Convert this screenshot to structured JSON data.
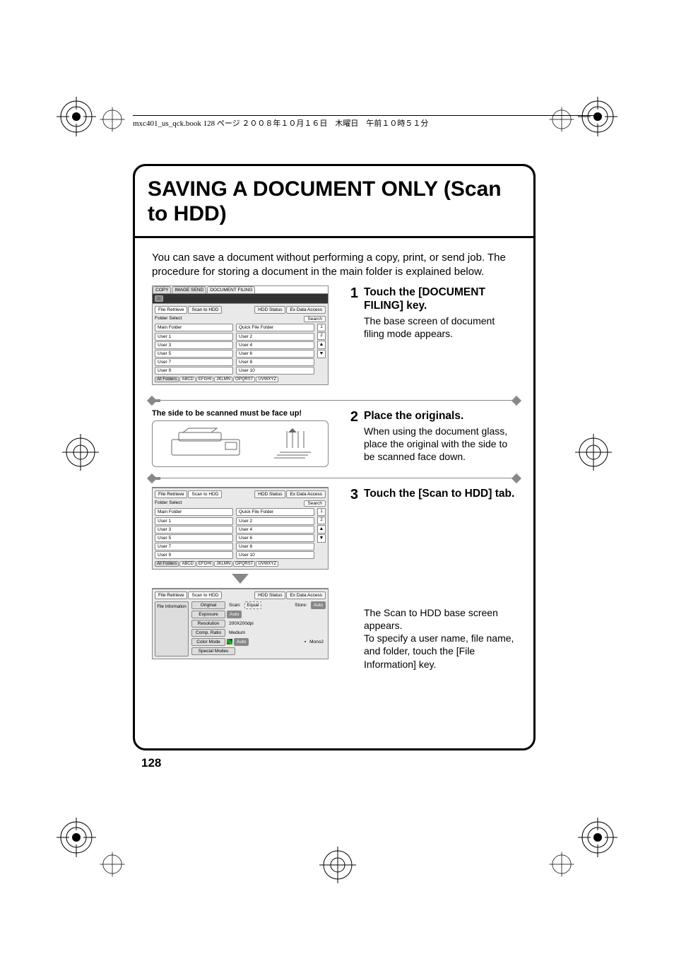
{
  "header": "mxc401_us_qck.book  128 ページ  ２００８年１０月１６日　木曜日　午前１０時５１分",
  "title": "SAVING A DOCUMENT ONLY (Scan to HDD)",
  "intro": "You can save a document without performing a copy, print, or send job. The procedure for storing a document in the main folder is explained below.",
  "steps": [
    {
      "num": "1",
      "title": "Touch the [DOCUMENT FILING] key.",
      "text": "The base screen of document filing mode appears."
    },
    {
      "num": "2",
      "title": "Place the originals.",
      "text": "When using the document glass, place the original with the side to be scanned face down."
    },
    {
      "num": "3",
      "title": "Touch the [Scan to HDD] tab.",
      "text": ""
    }
  ],
  "note_faceup": "The side to be scanned must be face up!",
  "step4_text": "The Scan to HDD base screen appears.\nTo specify a user name, file name, and folder, touch the [File Information] key.",
  "page_number": "128",
  "panel_top": {
    "top_tabs": [
      "COPY",
      "IMAGE SEND",
      "DOCUMENT FILING"
    ],
    "sub_tabs": [
      "File Retrieve",
      "Scan to HDD",
      "HDD Status",
      "Ex Data Access"
    ],
    "folder_select": "Folder Select",
    "search": "Search",
    "main_folder": "Main Folder",
    "quick_folder": "Quick File Folder",
    "users_left": [
      "User 1",
      "User 3",
      "User 5",
      "User 7",
      "User 9"
    ],
    "users_right": [
      "User 2",
      "User 4",
      "User 6",
      "User 8",
      "User 10"
    ],
    "page_indicator": [
      "1",
      "2"
    ],
    "alpha": [
      "All Folders",
      "ABCD",
      "EFGHI",
      "JKLMN",
      "OPQRST",
      "UVWXYZ"
    ]
  },
  "panel_mid": {
    "sub_tabs": [
      "File Retrieve",
      "Scan to HDD",
      "HDD Status",
      "Ex Data Access"
    ],
    "folder_select": "Folder Select",
    "search": "Search",
    "main_folder": "Main Folder",
    "quick_folder": "Quick File Folder",
    "users_left": [
      "User 1",
      "User 3",
      "User 5",
      "User 7",
      "User 9"
    ],
    "users_right": [
      "User 2",
      "User 4",
      "User 6",
      "User 8",
      "User 10"
    ],
    "page_indicator": [
      "1",
      "2"
    ],
    "alpha": [
      "All Folders",
      "ABCD",
      "EFGHI",
      "JKLMN",
      "OPQRST",
      "UVWXYZ"
    ]
  },
  "panel_bottom": {
    "sub_tabs": [
      "File Retrieve",
      "Scan to HDD",
      "HDD Status",
      "Ex Data Access"
    ],
    "file_info": "File Information",
    "rows": {
      "original": {
        "k": "Original",
        "scan_lbl": "Scan:",
        "scan_v": "Equal",
        "store_lbl": "Store:",
        "store_v": "Auto"
      },
      "exposure": {
        "k": "Exposure",
        "v": "Auto"
      },
      "resolution": {
        "k": "Resolution",
        "v": "200X200dpi"
      },
      "comp": {
        "k": "Comp. Ratio",
        "v": "Medium"
      },
      "color": {
        "k": "Color Mode",
        "v": "Auto",
        "mono": "Mono2"
      },
      "special": {
        "k": "Special Modes"
      }
    }
  }
}
